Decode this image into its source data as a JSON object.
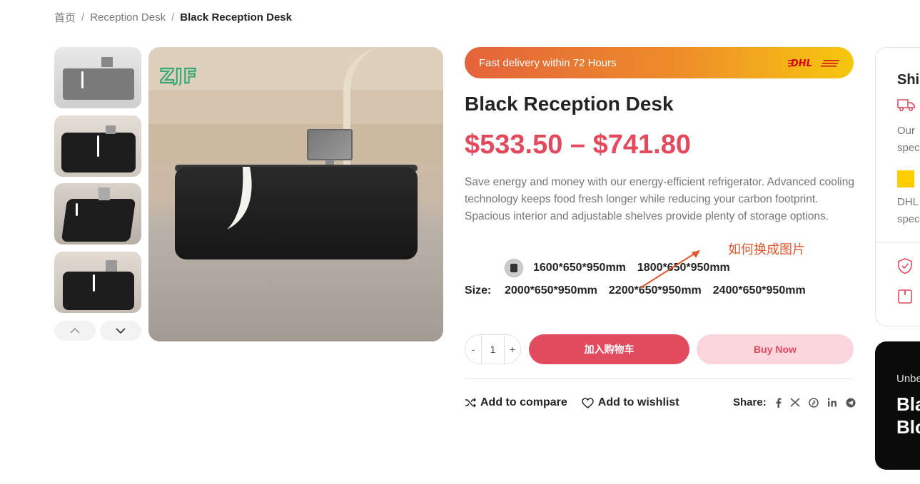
{
  "breadcrumb": {
    "home": "首页",
    "category": "Reception Desk",
    "current": "Black Reception Desk",
    "separator": "/"
  },
  "gallery": {
    "thumbnail_count": 4,
    "nav_icons": [
      "chevron-up-icon",
      "chevron-down-icon"
    ],
    "logo_text": "ZJF"
  },
  "product": {
    "delivery_banner": "Fast delivery within 72 Hours",
    "delivery_logo": "DHL",
    "title": "Black Reception Desk",
    "price": "$533.50 – $741.80",
    "description": "Save energy and money with our energy-efficient refrigerator. Advanced cooling technology keeps food fresh longer while reducing your carbon footprint. Spacious interior and adjustable shelves provide plenty of storage options.",
    "size_label": "Size:",
    "sizes_row1": [
      "1600*650*950mm",
      "1800*650*950mm"
    ],
    "sizes_row2": [
      "2000*650*950mm",
      "2200*650*950mm",
      "2400*650*950mm"
    ],
    "annotation": "如何换成图片",
    "quantity": {
      "minus": "-",
      "value": "1",
      "plus": "+"
    },
    "add_to_cart": "加入购物车",
    "buy_now": "Buy Now",
    "add_to_compare": "Add to compare",
    "add_to_wishlist": "Add to wishlist",
    "share_label": "Share:",
    "share_icons": [
      "facebook-icon",
      "x-icon",
      "pinterest-icon",
      "linkedin-icon",
      "telegram-icon"
    ]
  },
  "sidebar": {
    "shipping_title": "Ship",
    "shipping_text": [
      "Our",
      "spec"
    ],
    "dhl_text": [
      "DHL",
      "spec"
    ],
    "promo_small": "Unbe",
    "promo_big": [
      "Bla",
      "Blo"
    ]
  },
  "colors": {
    "accent": "#e24b5e",
    "accent_light": "#fad6dc",
    "banner_start": "#e3633b",
    "banner_end": "#f7c80e",
    "annotation": "#e0562c",
    "dhl_red": "#d40511",
    "dhl_yellow": "#ffcc00"
  }
}
